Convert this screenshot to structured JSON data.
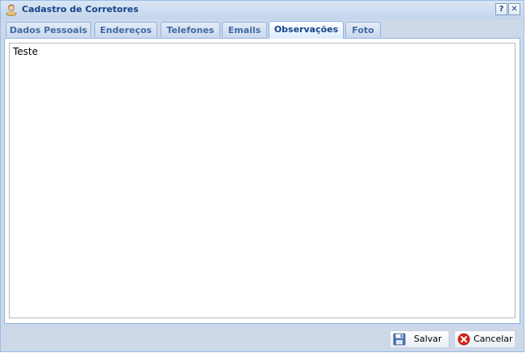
{
  "window": {
    "title": "Cadastro de Corretores",
    "help_label": "?",
    "close_label": "✕"
  },
  "tabs": [
    {
      "label": "Dados Pessoais",
      "active": false
    },
    {
      "label": "Endereços",
      "active": false
    },
    {
      "label": "Telefones",
      "active": false
    },
    {
      "label": "Emails",
      "active": false
    },
    {
      "label": "Observações",
      "active": true
    },
    {
      "label": "Foto",
      "active": false
    }
  ],
  "observacoes": {
    "value": "Teste"
  },
  "buttons": {
    "save_label": "Salvar",
    "cancel_label": "Cancelar"
  },
  "colors": {
    "title": "#15428b",
    "tab_text": "#416aa3",
    "border": "#99bbe8",
    "cancel_icon": "#d9261c"
  }
}
